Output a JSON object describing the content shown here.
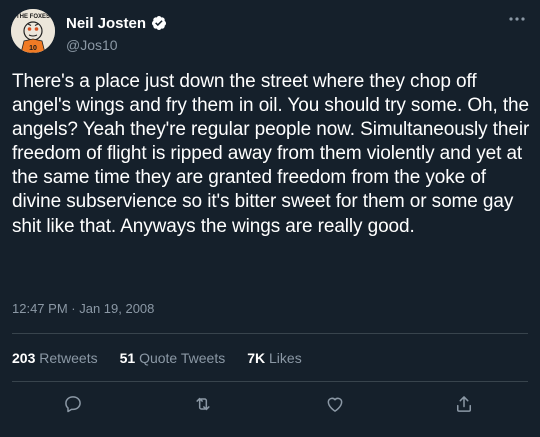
{
  "author": {
    "name": "Neil Josten",
    "handle": "@Jos10",
    "avatar_text": "10",
    "avatar_header_text": "THE FOXES"
  },
  "icons": {
    "verified": "verified-badge-icon",
    "more": "more-horizontal-icon",
    "reply": "reply-icon",
    "retweet": "retweet-icon",
    "like": "heart-icon",
    "share": "share-icon"
  },
  "tweet": {
    "text": "There's a place just down the street where they chop off angel's wings and fry them in oil. You should try some. Oh, the angels? Yeah they're regular people now. Simultaneously their freedom of flight is ripped away from them violently and yet at the same time they are granted freedom from the yoke of divine subservience so it's bitter sweet for them or some gay shit like that. Anyways the wings are really good.",
    "time": "12:47 PM",
    "separator": " · ",
    "date": "Jan 19, 2008"
  },
  "stats": {
    "retweets_count": "203",
    "retweets_label": "Retweets",
    "quotes_count": "51",
    "quotes_label": "Quote Tweets",
    "likes_count": "7K",
    "likes_label": "Likes"
  },
  "colors": {
    "background": "#15202b",
    "text": "#ffffff",
    "muted": "#8b98a5",
    "divider": "#38444d",
    "verified": "#ffffff"
  }
}
